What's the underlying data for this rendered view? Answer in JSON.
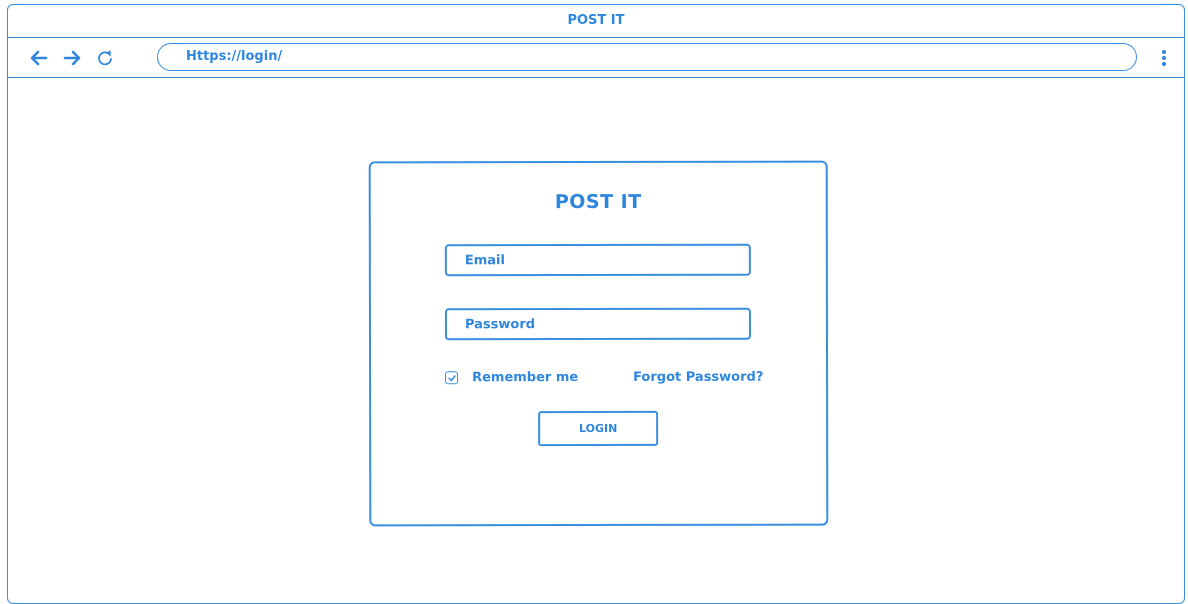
{
  "window": {
    "title": "POST IT"
  },
  "browser": {
    "back_icon": "arrow-left-icon",
    "forward_icon": "arrow-right-icon",
    "reload_icon": "reload-icon",
    "address": "Https://login/",
    "menu_icon": "vertical-dots-icon"
  },
  "login": {
    "title": "POST IT",
    "email_placeholder": "Email",
    "password_placeholder": "Password",
    "remember_label": "Remember me",
    "remember_checked": true,
    "forgot_label": "Forgot Password?",
    "button_label": "LOGIN"
  },
  "colors": {
    "accent": "#2f86dd",
    "background": "#ffffff"
  }
}
